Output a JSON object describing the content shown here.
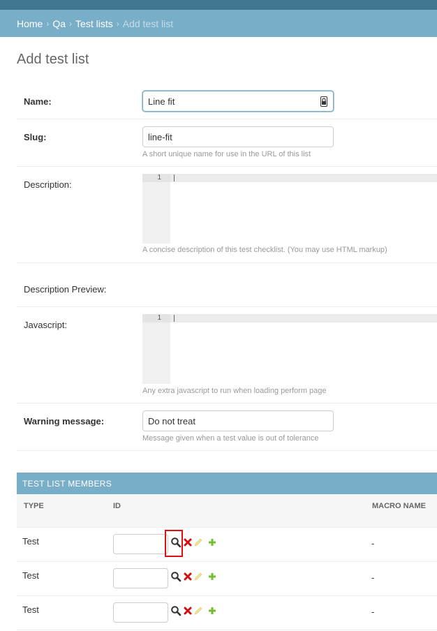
{
  "breadcrumbs": {
    "items": [
      "Home",
      "Qa",
      "Test lists"
    ],
    "current": "Add test list",
    "separator": "›"
  },
  "page_title": "Add test list",
  "form": {
    "name": {
      "label": "Name:",
      "value": "Line fit"
    },
    "slug": {
      "label": "Slug:",
      "value": "line-fit",
      "help": "A short unique name for use in the URL of this list"
    },
    "description": {
      "label": "Description:",
      "line_number": "1",
      "help": "A concise description of this test checklist. (You may use HTML markup)"
    },
    "description_preview": {
      "label": "Description Preview:"
    },
    "javascript": {
      "label": "Javascript:",
      "line_number": "1",
      "help": "Any extra javascript to run when loading perform page"
    },
    "warning_message": {
      "label": "Warning message:",
      "value": "Do not treat",
      "help": "Message given when a test value is out of tolerance"
    }
  },
  "members": {
    "caption": "TEST LIST MEMBERS",
    "columns": [
      "TYPE",
      "ID",
      "MACRO NAME"
    ],
    "rows": [
      {
        "type": "Test",
        "macro_name": "-"
      },
      {
        "type": "Test",
        "macro_name": "-"
      },
      {
        "type": "Test",
        "macro_name": "-"
      }
    ]
  },
  "icons": {
    "lookup": "search-icon",
    "delete": "delete-icon",
    "change": "pencil-icon",
    "add": "add-icon",
    "password_manager": "password-manager-icon"
  },
  "colors": {
    "header": "#417690",
    "breadcrumb_bar": "#79aec8",
    "delete": "#cc1111",
    "add": "#70bf2b",
    "change": "#efe39a"
  }
}
